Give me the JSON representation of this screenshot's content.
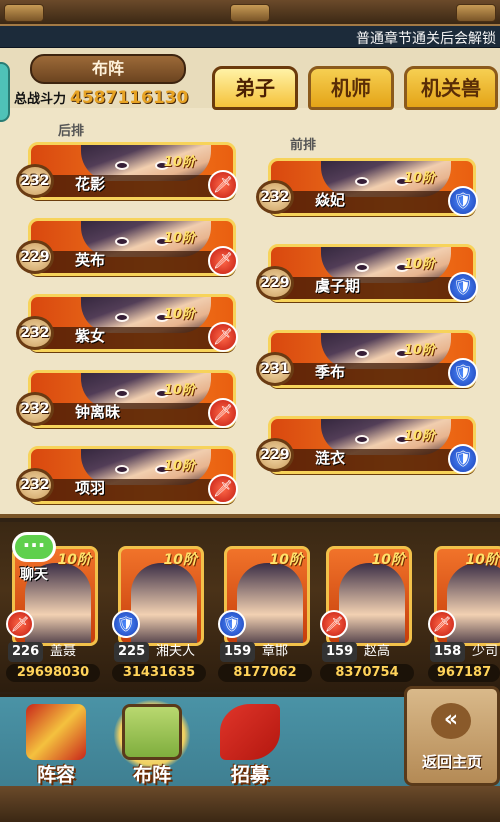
{
  "notice": "普通章节通关后会解锁",
  "header": {
    "title": "布阵",
    "power_label": "总战斗力",
    "power_value": "4587116130"
  },
  "tabs": [
    {
      "label": "弟子",
      "active": true
    },
    {
      "label": "机师",
      "active": false
    },
    {
      "label": "机关兽",
      "active": false
    }
  ],
  "back_row": {
    "label": "后排",
    "heroes": [
      {
        "name": "花影",
        "level": "232",
        "rank": "10阶",
        "type": "sword"
      },
      {
        "name": "英布",
        "level": "229",
        "rank": "10阶",
        "type": "sword"
      },
      {
        "name": "紫女",
        "level": "232",
        "rank": "10阶",
        "type": "sword"
      },
      {
        "name": "钟离昧",
        "level": "232",
        "rank": "10阶",
        "type": "sword"
      },
      {
        "name": "项羽",
        "level": "232",
        "rank": "10阶",
        "type": "sword"
      }
    ]
  },
  "front_row": {
    "label": "前排",
    "heroes": [
      {
        "name": "焱妃",
        "level": "232",
        "rank": "10阶",
        "type": "shield"
      },
      {
        "name": "虞子期",
        "level": "229",
        "rank": "10阶",
        "type": "shield"
      },
      {
        "name": "季布",
        "level": "231",
        "rank": "10阶",
        "type": "shield"
      },
      {
        "name": "涟衣",
        "level": "229",
        "rank": "10阶",
        "type": "shield"
      }
    ]
  },
  "chat": {
    "label": "聊天"
  },
  "roster": [
    {
      "level": "226",
      "name": "盖聂",
      "power": "29698030",
      "rank": "10阶",
      "type": "sword"
    },
    {
      "level": "225",
      "name": "湘夫人",
      "power": "31431635",
      "rank": "10阶",
      "type": "shield"
    },
    {
      "level": "159",
      "name": "章邯",
      "power": "8177062",
      "rank": "10阶",
      "type": "shield"
    },
    {
      "level": "159",
      "name": "赵高",
      "power": "8370754",
      "rank": "10阶",
      "type": "sword"
    },
    {
      "level": "158",
      "name": "少司",
      "power": "967187",
      "rank": "10阶",
      "type": "sword"
    }
  ],
  "nav": [
    {
      "label": "阵容",
      "selected": false
    },
    {
      "label": "布阵",
      "selected": true
    },
    {
      "label": "招募",
      "selected": false
    }
  ],
  "back_button": {
    "label": "返回主页",
    "glyph": "«"
  },
  "glyphs": {
    "sword": "🗡",
    "shield": "🛡"
  },
  "colors": {
    "accent": "#f07a1d",
    "gold": "#f7d35a",
    "sword": "#d0231a",
    "shield": "#2a58d0"
  }
}
